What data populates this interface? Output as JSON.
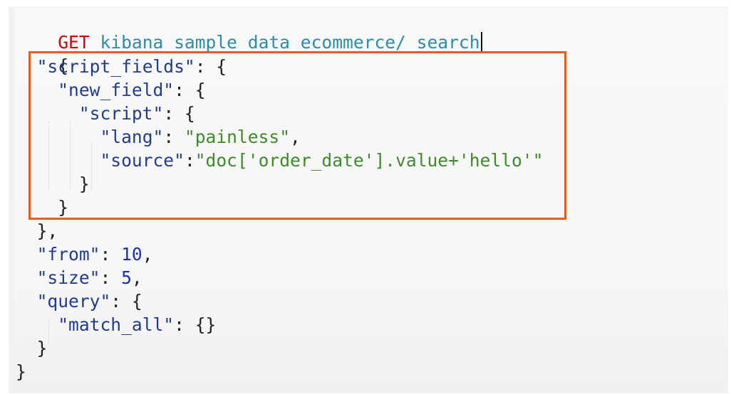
{
  "request": {
    "method": "GET",
    "endpoint": "kibana_sample_data_ecommerce/_search"
  },
  "body": {
    "open_brace": "{",
    "close_brace": "}",
    "script_fields_key": "\"script_fields\"",
    "new_field_key": "\"new_field\"",
    "script_key": "\"script\"",
    "lang_key": "\"lang\"",
    "lang_value": "\"painless\"",
    "source_key": "\"source\"",
    "source_value": "\"doc['order_date'].value+'hello'\"",
    "from_key": "\"from\"",
    "from_value": "10",
    "size_key": "\"size\"",
    "size_value": "5",
    "query_key": "\"query\"",
    "match_all_key": "\"match_all\"",
    "match_all_value": "{}"
  },
  "colors": {
    "method": "#c5060b",
    "endpoint": "#2b8ea6",
    "key": "#1f3c8f",
    "string": "#3e8b2a",
    "number": "#1a33b5",
    "highlight_border": "#e0601f"
  }
}
